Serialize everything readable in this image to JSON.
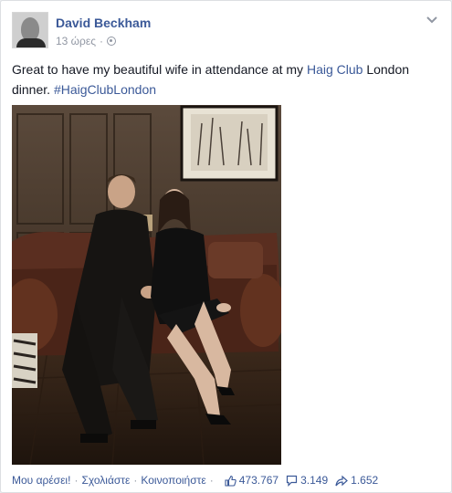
{
  "post": {
    "author": "David Beckham",
    "timestamp": "13 ώρες",
    "separator": "·",
    "privacy_icon": "globe-icon",
    "menu_icon": "chevron-down-icon",
    "message": {
      "part1": "Great to have my beautiful wife in attendance at my ",
      "link1": "Haig Club",
      "part2": " London dinner. ",
      "hashtag": "#HaigClubLondon"
    },
    "photo_icon": "photo"
  },
  "footer": {
    "like": "Μου αρέσει!",
    "comment": "Σχολιάστε",
    "share": "Κοινοποιήστε",
    "dot": "·",
    "likes_count": "473.767",
    "comments_count": "3.149",
    "shares_count": "1.652",
    "icons": [
      "thumbs-up-icon",
      "comment-icon",
      "share-arrow-icon"
    ]
  },
  "colors": {
    "link": "#3b5998",
    "meta": "#9197a3",
    "text": "#141823"
  }
}
